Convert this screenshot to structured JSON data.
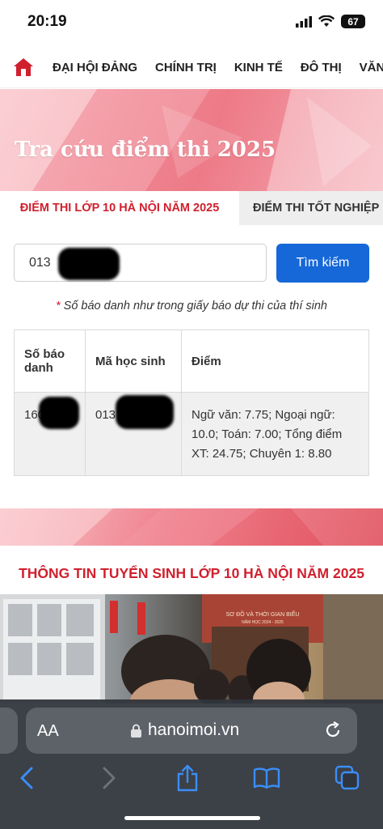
{
  "status": {
    "time": "20:19",
    "battery": "67"
  },
  "nav": {
    "items": [
      "ĐẠI HỘI ĐẢNG",
      "CHÍNH TRỊ",
      "KINH TẾ",
      "ĐÔ THỊ",
      "VĂN"
    ]
  },
  "banner": {
    "title": "Tra cứu điểm thi 2025"
  },
  "tabs": {
    "active": "ĐIỂM THI LỚP 10 HÀ NỘI NĂM 2025",
    "inactive": "ĐIỂM THI TỐT NGHIỆP"
  },
  "search": {
    "value": "013",
    "button": "Tìm kiếm"
  },
  "hint": {
    "star": "*",
    "text": " Số báo danh như trong giấy báo dự thi của thí sinh"
  },
  "table": {
    "headers": [
      "Số báo danh",
      "Mã học sinh",
      "Điểm"
    ],
    "rows": [
      [
        "160",
        "013",
        "Ngữ văn: 7.75; Ngoại ngữ: 10.0; Toán: 7.00; Tổng điểm XT: 24.75; Chuyên 1: 8.80"
      ]
    ]
  },
  "section": {
    "title": "THÔNG TIN TUYỂN SINH LỚP 10 HÀ NỘI NĂM 2025"
  },
  "photo": {
    "sign_title": "SƠ ĐỒ VÀ THỜI GIAN BIỂU",
    "sign_sub": "NĂM HỌC 2024 - 2025"
  },
  "safari": {
    "aa": "AA",
    "url": "hanoimoi.vn"
  },
  "colors": {
    "accent": "#d0202e",
    "button": "#1668d8"
  }
}
